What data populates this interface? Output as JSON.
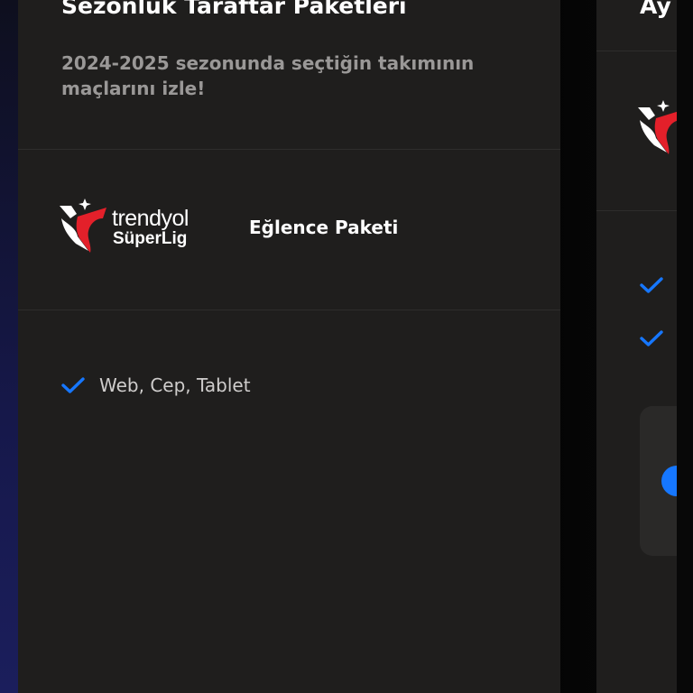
{
  "main_card": {
    "title": "Sezonluk Taraftar Paketleri",
    "subtitle": "2024-2025 sezonunda seçtiğin takımının maçlarını izle!",
    "logo": {
      "icon": "trendyol-superlig-logo",
      "line1": "trendyol",
      "line2": "SüperLig"
    },
    "package_name": "Eğlence Paketi",
    "features": [
      {
        "icon": "check-icon",
        "label": "Web, Cep, Tablet"
      }
    ]
  },
  "next_card": {
    "title_partial": "Ay",
    "logo_icon": "trendyol-superlig-logo",
    "check_count": 2
  },
  "colors": {
    "card_bg": "#1f1e1d",
    "accent_blue": "#1677ff",
    "logo_red": "#e3202a",
    "subtitle_gray": "#9a9897"
  }
}
